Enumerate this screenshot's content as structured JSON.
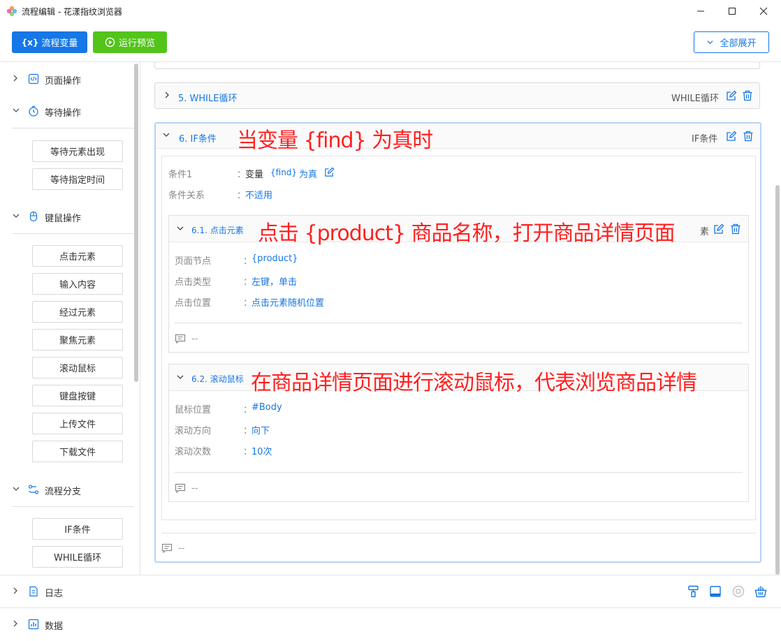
{
  "window": {
    "title": "流程编辑 - 花漾指纹浏览器"
  },
  "toolbar": {
    "variables_label": "流程变量",
    "run_preview_label": "运行预览",
    "expand_all_label": "全部展开"
  },
  "sidebar": {
    "groups": [
      {
        "label": "页面操作",
        "icon": "code-page-icon"
      },
      {
        "label": "等待操作",
        "icon": "stopwatch-icon",
        "items": [
          "等待元素出现",
          "等待指定时间"
        ]
      },
      {
        "label": "键鼠操作",
        "icon": "mouse-icon",
        "items": [
          "点击元素",
          "输入内容",
          "经过元素",
          "聚焦元素",
          "滚动鼠标",
          "键盘按键",
          "上传文件",
          "下载文件"
        ]
      },
      {
        "label": "流程分支",
        "icon": "branch-icon",
        "items": [
          "IF条件",
          "WHILE循环"
        ]
      }
    ]
  },
  "main": {
    "card5": {
      "title": "5. WHILE循环",
      "tag": "WHILE循环"
    },
    "card6": {
      "title": "6. IF条件",
      "tag": "IF条件",
      "cond1_label": "条件1",
      "cond1_prefix": "变量",
      "cond1_var": "{find}",
      "cond1_suffix": "为真",
      "rel_label": "条件关系",
      "rel_value": "不适用",
      "colon": "：",
      "sub1": {
        "title": "6.1. 点击元素",
        "hidden_tag_fragment": "素",
        "rows": [
          {
            "k": "页面节点",
            "v": "{product}"
          },
          {
            "k": "点击类型",
            "v": "左键，单击"
          },
          {
            "k": "点击位置",
            "v": "点击元素随机位置"
          }
        ],
        "comment": "--"
      },
      "sub2": {
        "title": "6.2. 滚动鼠标",
        "rows": [
          {
            "k": "鼠标位置",
            "v": "#Body"
          },
          {
            "k": "滚动方向",
            "v": "向下"
          },
          {
            "k": "滚动次数",
            "v": "10次"
          }
        ],
        "comment": "--"
      },
      "comment": "--"
    }
  },
  "bottom": {
    "log_label": "日志",
    "data_label": "数据"
  },
  "annotations": {
    "a1": "当变量 {find} 为真时",
    "a2": "点击 {product} 商品名称，打开商品详情页面",
    "a3": "在商品详情页面进行滚动鼠标，代表浏览商品详情"
  },
  "colors": {
    "primary": "#1677e6",
    "success": "#52c41a",
    "annotation": "#ff2020"
  }
}
